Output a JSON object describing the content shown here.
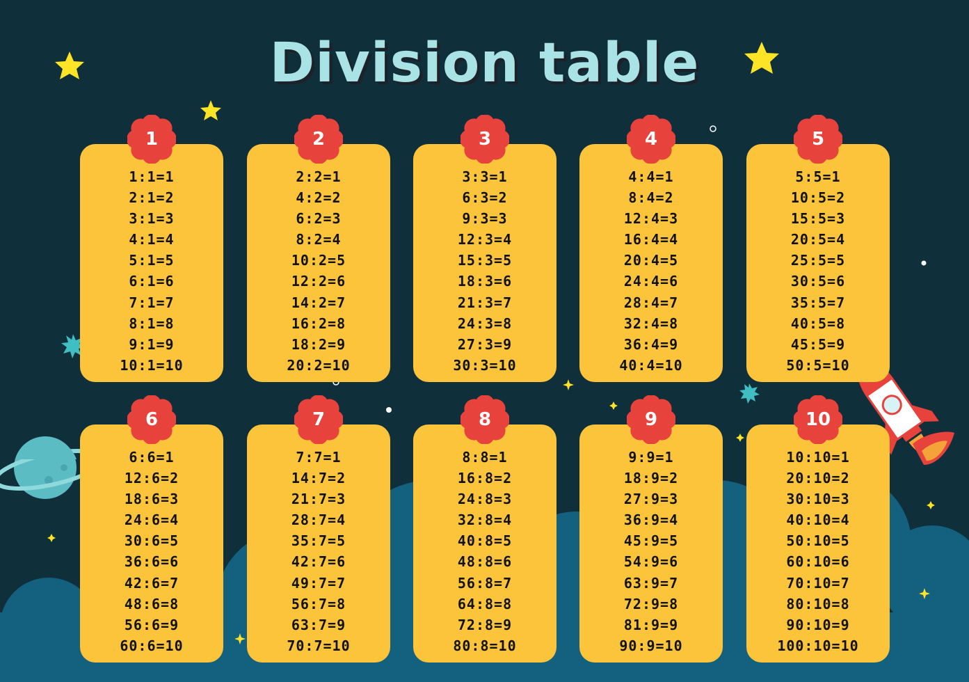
{
  "title": "Division table",
  "colors": {
    "background": "#0f2f3a",
    "cloud": "#14607f",
    "card": "#fbc43a",
    "badge": "#e8423c",
    "title": "#a9e3e6",
    "star": "#fde427"
  },
  "icons": [
    "star-icon",
    "planet-icon",
    "rocket-icon",
    "cloud-shape",
    "flower-badge"
  ],
  "tables": [
    {
      "number": "1",
      "rows": [
        "1:1=1",
        "2:1=2",
        "3:1=3",
        "4:1=4",
        "5:1=5",
        "6:1=6",
        "7:1=7",
        "8:1=8",
        "9:1=9",
        "10:1=10"
      ]
    },
    {
      "number": "2",
      "rows": [
        "2:2=1",
        "4:2=2",
        "6:2=3",
        "8:2=4",
        "10:2=5",
        "12:2=6",
        "14:2=7",
        "16:2=8",
        "18:2=9",
        "20:2=10"
      ]
    },
    {
      "number": "3",
      "rows": [
        "3:3=1",
        "6:3=2",
        "9:3=3",
        "12:3=4",
        "15:3=5",
        "18:3=6",
        "21:3=7",
        "24:3=8",
        "27:3=9",
        "30:3=10"
      ]
    },
    {
      "number": "4",
      "rows": [
        "4:4=1",
        "8:4=2",
        "12:4=3",
        "16:4=4",
        "20:4=5",
        "24:4=6",
        "28:4=7",
        "32:4=8",
        "36:4=9",
        "40:4=10"
      ]
    },
    {
      "number": "5",
      "rows": [
        "5:5=1",
        "10:5=2",
        "15:5=3",
        "20:5=4",
        "25:5=5",
        "30:5=6",
        "35:5=7",
        "40:5=8",
        "45:5=9",
        "50:5=10"
      ]
    },
    {
      "number": "6",
      "rows": [
        "6:6=1",
        "12:6=2",
        "18:6=3",
        "24:6=4",
        "30:6=5",
        "36:6=6",
        "42:6=7",
        "48:6=8",
        "56:6=9",
        "60:6=10"
      ]
    },
    {
      "number": "7",
      "rows": [
        "7:7=1",
        "14:7=2",
        "21:7=3",
        "28:7=4",
        "35:7=5",
        "42:7=6",
        "49:7=7",
        "56:7=8",
        "63:7=9",
        "70:7=10"
      ]
    },
    {
      "number": "8",
      "rows": [
        "8:8=1",
        "16:8=2",
        "24:8=3",
        "32:8=4",
        "40:8=5",
        "48:8=6",
        "56:8=7",
        "64:8=8",
        "72:8=9",
        "80:8=10"
      ]
    },
    {
      "number": "9",
      "rows": [
        "9:9=1",
        "18:9=2",
        "27:9=3",
        "36:9=4",
        "45:9=5",
        "54:9=6",
        "63:9=7",
        "72:9=8",
        "81:9=9",
        "90:9=10"
      ]
    },
    {
      "number": "10",
      "rows": [
        "10:10=1",
        "20:10=2",
        "30:10=3",
        "40:10=4",
        "50:10=5",
        "60:10=6",
        "70:10=7",
        "80:10=8",
        "90:10=9",
        "100:10=10"
      ]
    }
  ]
}
